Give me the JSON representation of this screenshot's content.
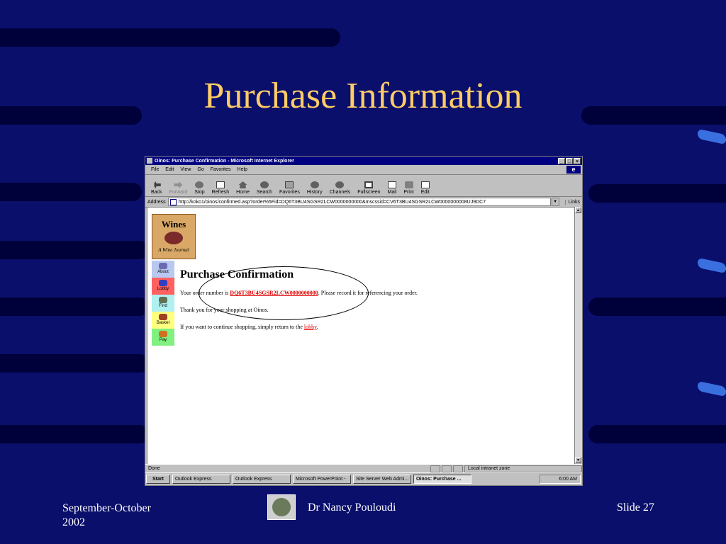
{
  "slide": {
    "title": "Purchase Information",
    "footer_date": "September-October\n2002",
    "footer_author": "Dr Nancy Pouloudi",
    "footer_slide": "Slide 27"
  },
  "browser": {
    "window_title": "Oinos: Purchase Confirmation - Microsoft Internet Explorer",
    "menu": [
      "File",
      "Edit",
      "View",
      "Go",
      "Favorites",
      "Help"
    ],
    "toolbar": [
      {
        "label": "Back",
        "icon": "back-arrow-icon"
      },
      {
        "label": "Forward",
        "icon": "forward-arrow-icon"
      },
      {
        "label": "Stop",
        "icon": "stop-icon"
      },
      {
        "label": "Refresh",
        "icon": "refresh-icon"
      },
      {
        "label": "Home",
        "icon": "home-icon"
      },
      {
        "label": "Search",
        "icon": "search-icon"
      },
      {
        "label": "Favorites",
        "icon": "favorites-icon"
      },
      {
        "label": "History",
        "icon": "history-icon"
      },
      {
        "label": "Channels",
        "icon": "channels-icon"
      },
      {
        "label": "Fullscreen",
        "icon": "fullscreen-icon"
      },
      {
        "label": "Mail",
        "icon": "mail-icon"
      },
      {
        "label": "Print",
        "icon": "print-icon"
      },
      {
        "label": "Edit",
        "icon": "edit-icon"
      }
    ],
    "address_label": "Address",
    "address_value": "http://koko1/oinos/confirmed.asp?order%5Fid=DQ6T3BU4SGSR2LCW0000000000&mscssid=CV6T3BU4SGSR2LCW0000000008UJ9DC7",
    "links_label": "Links",
    "status_text": "Done",
    "zone_text": "Local intranet zone"
  },
  "page": {
    "logo_text": "Wines",
    "logo_subtext": "A Wine Journal",
    "nav": [
      {
        "label": "About",
        "color": "#b8c8f0"
      },
      {
        "label": "Lobby",
        "color": "#ff6060"
      },
      {
        "label": "Find",
        "color": "#b0f0f0"
      },
      {
        "label": "Basket",
        "color": "#ffff80"
      },
      {
        "label": "Pay",
        "color": "#80f080"
      }
    ],
    "heading": "Purchase Confirmation",
    "order_prefix": "Your order number is ",
    "order_number": "DQ6T3BU4SGSR2LCW0000000000",
    "order_suffix": ". Please record it for referencing your order.",
    "thanks": "Thank you for your shopping at Oinos.",
    "continue_prefix": "If you want to continue shopping, simply return to the ",
    "continue_link": "lobby",
    "continue_suffix": "."
  },
  "taskbar": {
    "start": "Start",
    "tasks": [
      "Outlook Express",
      "Outlook Express",
      "Microsoft PowerPoint -",
      "Site Server Web Admi...",
      "Oinos: Purchase ..."
    ],
    "clock": "6:00 AM"
  }
}
